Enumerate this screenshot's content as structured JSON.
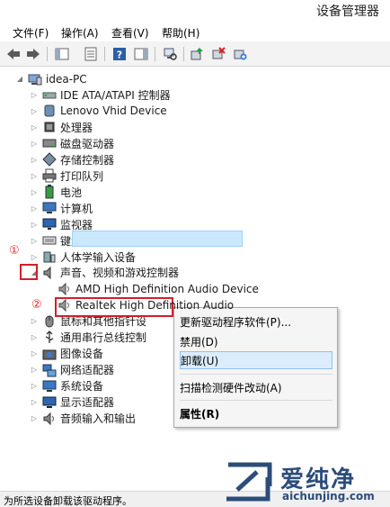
{
  "window": {
    "title": "设备管理器"
  },
  "menu": [
    {
      "label": "文件(F)"
    },
    {
      "label": "操作(A)"
    },
    {
      "label": "查看(V)"
    },
    {
      "label": "帮助(H)"
    }
  ],
  "toolbar_icons": [
    "back-arrow-icon",
    "forward-arrow-icon",
    "show-hide-console-tree-icon",
    "properties-icon",
    "help-icon",
    "action-pane-icon",
    "scan-hardware-icon",
    "update-driver-icon",
    "disable-device-icon",
    "uninstall-device-icon"
  ],
  "tree": {
    "root": {
      "label": "idea-PC",
      "expanded": true
    },
    "categories": [
      {
        "label": "IDE ATA/ATAPI 控制器",
        "icon": "ide-controller-icon",
        "expanded": false
      },
      {
        "label": "Lenovo Vhid Device",
        "icon": "hid-device-icon",
        "expanded": false
      },
      {
        "label": "处理器",
        "icon": "processor-icon",
        "expanded": false
      },
      {
        "label": "磁盘驱动器",
        "icon": "disk-drive-icon",
        "expanded": false
      },
      {
        "label": "存储控制器",
        "icon": "storage-controller-icon",
        "expanded": false
      },
      {
        "label": "打印队列",
        "icon": "printer-icon",
        "expanded": false
      },
      {
        "label": "电池",
        "icon": "battery-icon",
        "expanded": false
      },
      {
        "label": "计算机",
        "icon": "computer-icon",
        "expanded": false
      },
      {
        "label": "监视器",
        "icon": "monitor-icon",
        "expanded": false
      },
      {
        "label": "键盘",
        "icon": "keyboard-icon",
        "expanded": false
      },
      {
        "label": "人体学输入设备",
        "icon": "human-interface-icon",
        "expanded": false
      },
      {
        "label": "声音、视频和游戏控制器",
        "icon": "sound-icon",
        "expanded": true,
        "children": [
          {
            "label": "AMD High Definition Audio Device",
            "icon": "speaker-icon"
          },
          {
            "label": "Realtek High Definition Audio",
            "icon": "speaker-icon",
            "selected": true
          }
        ]
      },
      {
        "label": "鼠标和其他指针设",
        "icon": "mouse-icon",
        "expanded": false
      },
      {
        "label": "通用串行总线控制",
        "icon": "usb-icon",
        "expanded": false
      },
      {
        "label": "图像设备",
        "icon": "camera-icon",
        "expanded": false
      },
      {
        "label": "网络适配器",
        "icon": "network-adapter-icon",
        "expanded": false
      },
      {
        "label": "系统设备",
        "icon": "system-device-icon",
        "expanded": false
      },
      {
        "label": "显示适配器",
        "icon": "display-adapter-icon",
        "expanded": false
      },
      {
        "label": "音频输入和输出",
        "icon": "audio-io-icon",
        "expanded": false
      }
    ]
  },
  "context_menu": [
    {
      "label": "更新驱动程序软件(P)..."
    },
    {
      "label": "禁用(D)"
    },
    {
      "label": "卸载(U)",
      "highlighted": true
    },
    {
      "label": "扫描检测硬件改动(A)"
    },
    {
      "label": "属性(R)",
      "bold": true
    }
  ],
  "annotations": [
    "①",
    "②",
    "③"
  ],
  "status_text": "为所选设备卸载该驱动程序。",
  "watermark": {
    "text": "爱纯净",
    "url": "aichunjing.com"
  },
  "colors": {
    "annotation_red": "#d21f2a",
    "selection_bg": "#cce8ff",
    "menu_highlight": "#dcecfc"
  }
}
